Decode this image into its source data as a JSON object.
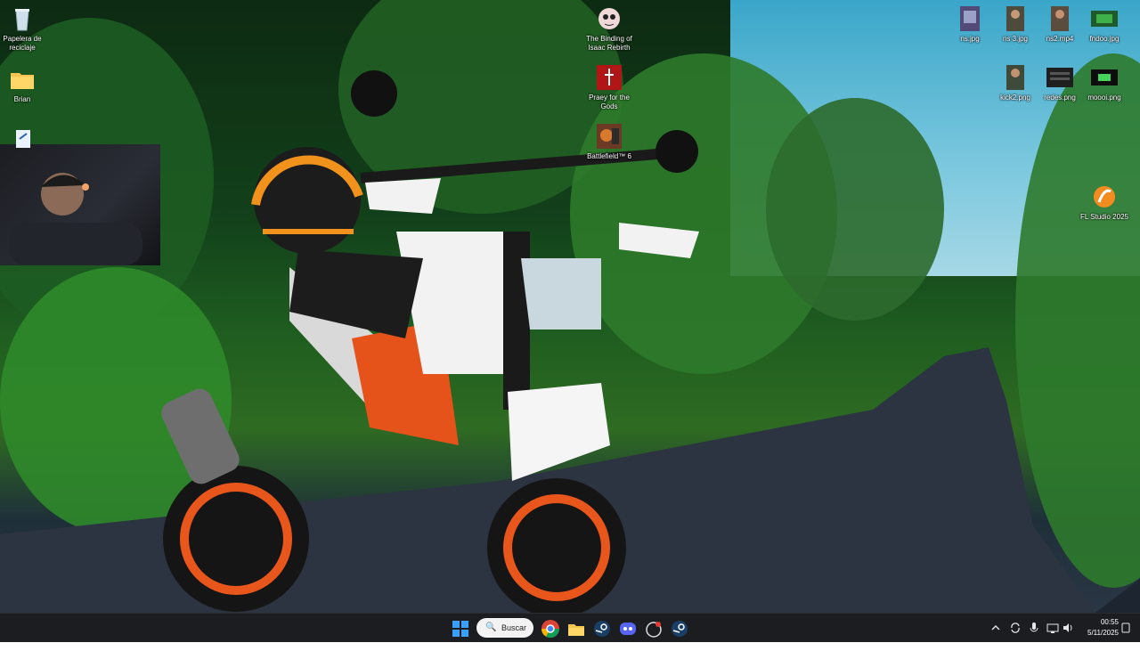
{
  "desktop": {
    "icons_left": [
      {
        "name": "recycle-bin",
        "label": "Papelera de reciclaje"
      },
      {
        "name": "folder-brian",
        "label": "Brian"
      }
    ],
    "icons_center": [
      {
        "name": "binding-of-isaac",
        "label": "The Binding of Isaac Rebirth"
      },
      {
        "name": "praey-for-the-gods",
        "label": "Praey for the Gods"
      },
      {
        "name": "battlefield-6",
        "label": "Battlefield™ 6"
      }
    ],
    "icons_right_row1": [
      {
        "name": "ns-jpg",
        "label": "ns.jpg"
      },
      {
        "name": "ns3-jpg",
        "label": "ns 3.jpg"
      },
      {
        "name": "ns2-mp4",
        "label": "ns2.mp4"
      },
      {
        "name": "fndoo-jpg",
        "label": "fndoo.jpg"
      }
    ],
    "icons_right_row2": [
      {
        "name": "kick2-png",
        "label": "kick2.png"
      },
      {
        "name": "redes-png",
        "label": "redes.png"
      },
      {
        "name": "moooi-png",
        "label": "moooi.png"
      }
    ],
    "fl_studio": {
      "label": "FL Studio 2025"
    }
  },
  "taskbar": {
    "search_label": "Buscar",
    "apps": [
      "start-icon",
      "chrome-icon",
      "file-explorer-icon",
      "steam-icon",
      "discord-icon",
      "app-icon",
      "steam-icon-2"
    ],
    "tray_icons": [
      "chevron-up-icon",
      "sync-icon",
      "mic-icon",
      "network-icon",
      "volume-icon"
    ],
    "time": "00:55",
    "date": "5/11/2025",
    "accent": "#0078d4"
  }
}
